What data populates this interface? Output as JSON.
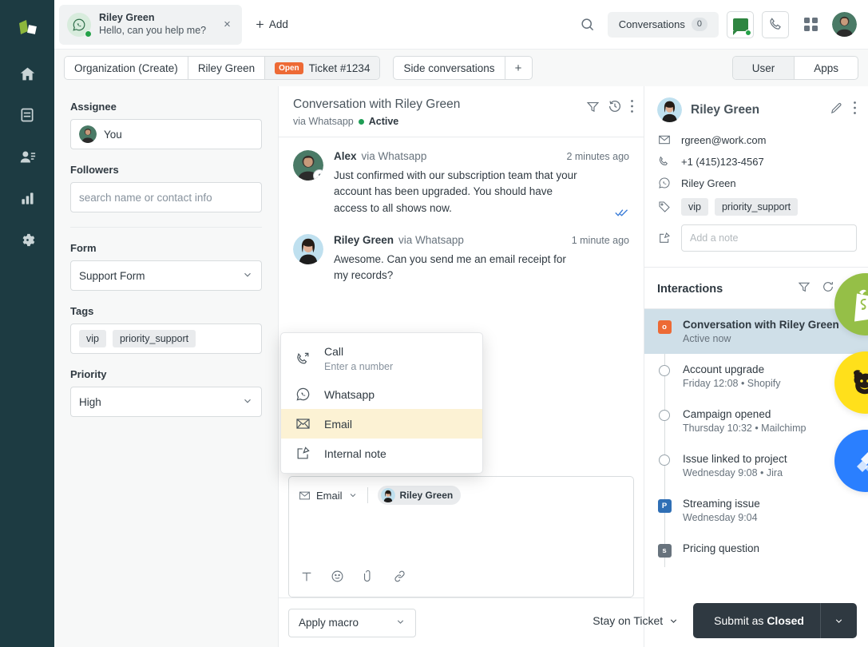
{
  "rail": {
    "items": [
      {
        "name": "logo",
        "label": "Crisp Logo"
      },
      {
        "name": "home",
        "label": "Home"
      },
      {
        "name": "inbox",
        "label": "Inbox"
      },
      {
        "name": "contacts",
        "label": "Contacts"
      },
      {
        "name": "analytics",
        "label": "Analytics"
      },
      {
        "name": "settings",
        "label": "Settings"
      }
    ]
  },
  "topbar": {
    "conversation_tab": {
      "name": "Riley Green",
      "preview": "Hello, can you help me?",
      "channel_icon": "whatsapp-icon",
      "close_label": "×"
    },
    "add_label": "Add",
    "search_icon": "search-icon",
    "conversations_pill": {
      "label": "Conversations",
      "count": "0"
    },
    "chat_icon": "chat-icon",
    "call_icon": "phone-icon",
    "apps_grid_icon": "grid-icon",
    "avatar": "user-avatar"
  },
  "breadcrumbs": {
    "items": [
      {
        "label": "Organization (Create)",
        "active": false
      },
      {
        "label": "Riley Green",
        "active": false
      },
      {
        "label": "Ticket #1234",
        "badge": "Open",
        "active": true
      }
    ],
    "side_conversations_label": "Side conversations",
    "add_side_label": "+",
    "toggle": {
      "options": [
        "User",
        "Apps"
      ],
      "selected": "User"
    }
  },
  "properties": {
    "assignee": {
      "label": "Assignee",
      "value": "You"
    },
    "followers": {
      "label": "Followers",
      "placeholder": "search name or contact info",
      "value": ""
    },
    "form": {
      "label": "Form",
      "value": "Support Form"
    },
    "tags": {
      "label": "Tags",
      "values": [
        "vip",
        "priority_support"
      ]
    },
    "priority": {
      "label": "Priority",
      "value": "High"
    }
  },
  "conversation": {
    "title": "Conversation with Riley Green",
    "via": "via Whatsapp",
    "status": "Active",
    "header_icons": [
      "filter-icon",
      "history-icon",
      "more-vertical-icon"
    ],
    "messages": [
      {
        "author": "Alex",
        "via": "via Whatsapp",
        "time": "2 minutes ago",
        "text": "Just confirmed with our subscription team that your account has been upgraded. You should have access to all shows now.",
        "read": true
      },
      {
        "author": "Riley Green",
        "via": "via Whatsapp",
        "time": "1 minute ago",
        "text": "Awesome. Can you send me an email receipt for my records?",
        "read": false
      }
    ]
  },
  "channel_menu": {
    "items": [
      {
        "label": "Call",
        "sub": "Enter a number",
        "icon": "phone-icon",
        "highlighted": false
      },
      {
        "label": "Whatsapp",
        "sub": "",
        "icon": "whatsapp-icon",
        "highlighted": false
      },
      {
        "label": "Email",
        "sub": "",
        "icon": "envelope-icon",
        "highlighted": true
      },
      {
        "label": "Internal note",
        "sub": "",
        "icon": "note-edit-icon",
        "highlighted": false
      }
    ]
  },
  "composer": {
    "channel": "Email",
    "recipient": "Riley Green",
    "tools": [
      "text-format-icon",
      "emoji-icon",
      "attachment-icon",
      "link-icon"
    ],
    "body": ""
  },
  "bottombar": {
    "macro_label": "Apply macro",
    "stay_label": "Stay on Ticket",
    "submit_prefix": "Submit as ",
    "submit_status": "Closed"
  },
  "contact": {
    "name": "Riley Green",
    "edit_icon": "pencil-icon",
    "more_icon": "more-vertical-icon",
    "email": "rgreen@work.com",
    "phone": "+1 (415)123-4567",
    "whatsapp": "Riley Green",
    "tags": [
      "vip",
      "priority_support"
    ],
    "note_placeholder": "Add a note"
  },
  "interactions": {
    "title": "Interactions",
    "icons": [
      "filter-icon",
      "refresh-icon",
      "chevron-down-icon"
    ],
    "items": [
      {
        "title": "Conversation with Riley Green",
        "meta": "Active now",
        "marker": "square",
        "marker_label": "o",
        "marker_color": "#ed6a35",
        "selected": true
      },
      {
        "title": "Account upgrade",
        "meta": "Friday 12:08 • Shopify",
        "marker": "circle",
        "marker_label": "",
        "marker_color": "",
        "selected": false
      },
      {
        "title": "Campaign opened",
        "meta": "Thursday 10:32 • Mailchimp",
        "marker": "circle",
        "marker_label": "",
        "marker_color": "",
        "selected": false
      },
      {
        "title": "Issue linked to project",
        "meta": "Wednesday 9:08 • Jira",
        "marker": "circle",
        "marker_label": "",
        "marker_color": "",
        "selected": false
      },
      {
        "title": "Streaming issue",
        "meta": "Wednesday 9:04",
        "marker": "square",
        "marker_label": "P",
        "marker_color": "#2f6fb5",
        "selected": false
      },
      {
        "title": "Pricing question",
        "meta": "",
        "marker": "square",
        "marker_label": "s",
        "marker_color": "#68737d",
        "selected": false
      }
    ]
  },
  "app_logos": [
    {
      "name": "shopify-logo",
      "color": "#95bf47"
    },
    {
      "name": "mailchimp-logo",
      "color": "#ffe01b"
    },
    {
      "name": "jira-logo",
      "color": "#2a7fff"
    }
  ],
  "colors": {
    "rail_bg": "#1d3b42",
    "accent_orange": "#ed6a35",
    "accent_green": "#24a148",
    "dark_button": "#2f3941",
    "highlight_yellow": "#fcf2d4",
    "selected_blue": "#cfdfe8"
  }
}
